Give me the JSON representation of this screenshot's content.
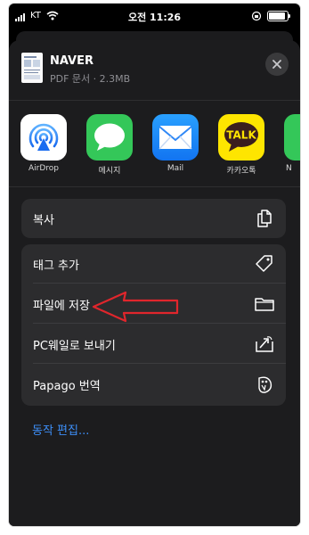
{
  "status_bar": {
    "carrier": "KT",
    "time": "오전 11:26",
    "battery_level": 0.9
  },
  "document": {
    "title": "NAVER",
    "meta": "PDF 문서 · 2.3MB"
  },
  "share_apps": [
    {
      "label": "AirDrop",
      "icon": "airdrop-icon",
      "color": "#2f7cf6"
    },
    {
      "label": "메시지",
      "icon": "messages-icon",
      "color": "#34c759"
    },
    {
      "label": "Mail",
      "icon": "mail-icon",
      "color": "#1a8cff"
    },
    {
      "label": "카카오톡",
      "icon": "kakaotalk-icon",
      "color": "#fee500",
      "logo_text": "TALK"
    },
    {
      "label": "N",
      "icon": "partial-app-icon",
      "color": "#34c759"
    }
  ],
  "actions": {
    "copy": {
      "label": "복사",
      "icon": "copy-icon"
    },
    "add_tags": {
      "label": "태그 추가",
      "icon": "tag-icon"
    },
    "save_to_files": {
      "label": "파일에 저장",
      "icon": "folder-icon"
    },
    "send_to_pc": {
      "label": "PC웨일로 보내기",
      "icon": "whale-send-icon"
    },
    "papago": {
      "label": "Papago 번역",
      "icon": "papago-icon"
    }
  },
  "edit_actions": "동작 편집...",
  "annotation": {
    "type": "red-arrow",
    "color": "#e0262c",
    "points_to": "save_to_files"
  }
}
